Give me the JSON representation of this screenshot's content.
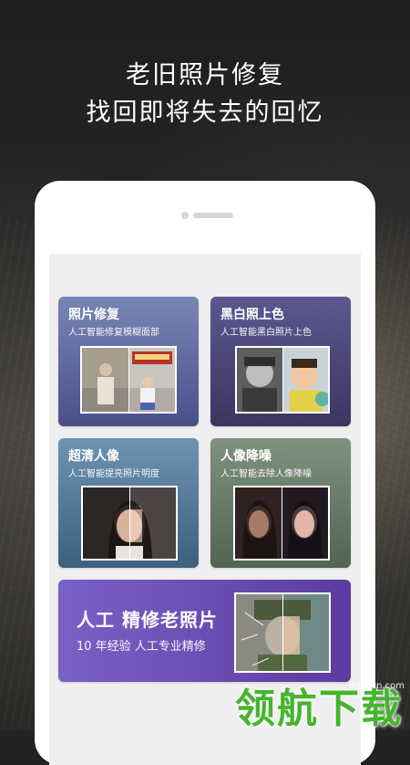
{
  "hero": {
    "line1": "老旧照片修复",
    "line2": "找回即将失去的回忆"
  },
  "features": [
    {
      "title": "照片修复",
      "subtitle": "人工智能修复模糊面部"
    },
    {
      "title": "黑白照上色",
      "subtitle": "人工智能黑白照片上色"
    },
    {
      "title": "超清人像",
      "subtitle": "人工智能提亮照片明度"
    },
    {
      "title": "人像降噪",
      "subtitle": "人工智能去除人像降噪"
    }
  ],
  "premium": {
    "title": "人工 精修老照片",
    "subtitle": "10 年经验 人工专业精修"
  },
  "watermark": {
    "url": "lhdown.com",
    "brand": "领航下载"
  },
  "colors": {
    "card1": "#6a76a9",
    "card2": "#4f4a7e",
    "card3": "#587f9f",
    "card4": "#6d7e6d",
    "premium": "#6a4eb6",
    "watermark": "#47b42f"
  }
}
